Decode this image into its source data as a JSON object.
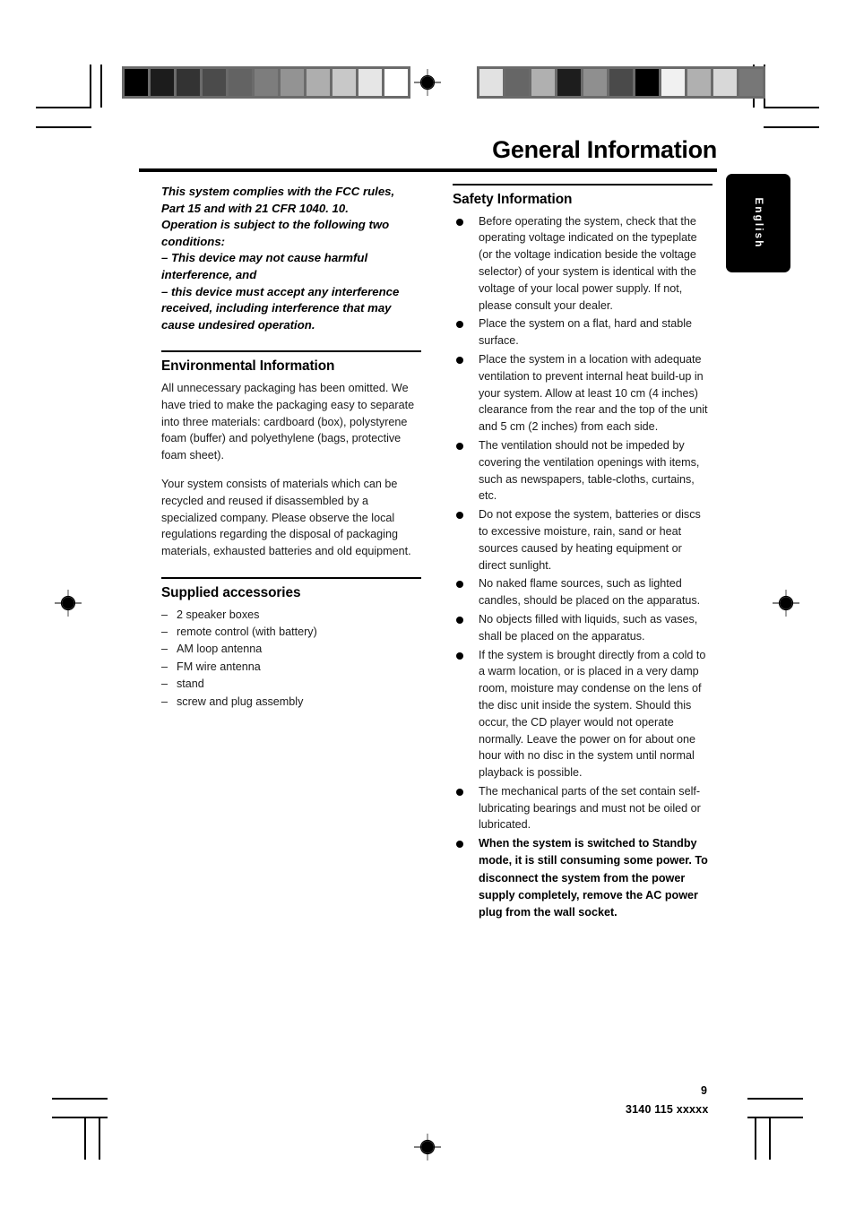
{
  "document": {
    "title": "General Information",
    "language_tab": "English",
    "page_number": "9",
    "doc_code": "3140 115 xxxxx"
  },
  "left_column": {
    "intro": {
      "lines": [
        "This system complies with the FCC rules,",
        "Part 15 and with 21 CFR 1040. 10.",
        "Operation is subject to the following two",
        "conditions:",
        "–    This device may not cause harmful",
        "interference, and",
        "–    this device must accept any interference",
        "received, including interference  that may",
        "cause undesired operation."
      ]
    },
    "environmental": {
      "heading": "Environmental Information",
      "paragraphs": [
        "All unnecessary packaging has been omitted. We have tried to make the packaging easy to separate into three materials: cardboard (box), polystyrene foam (buffer) and polyethylene (bags, protective foam sheet).",
        "Your system consists of materials which can be recycled and reused if disassembled by a specialized company. Please observe the local regulations regarding the disposal of packaging materials, exhausted batteries and old equipment."
      ]
    },
    "accessories": {
      "heading": "Supplied accessories",
      "dash": "–",
      "items": [
        "2 speaker boxes",
        "remote control (with battery)",
        "AM loop antenna",
        "FM wire antenna",
        "stand",
        "screw and plug assembly"
      ]
    }
  },
  "right_column": {
    "safety": {
      "heading": "Safety Information",
      "bullets": [
        {
          "text": "Before operating the system, check that the operating voltage indicated on the typeplate (or the voltage indication beside the voltage selector) of your system is identical with the voltage of your local power supply. If not, please consult your dealer.",
          "bold": false
        },
        {
          "text": "Place the system on a flat, hard and stable surface.",
          "bold": false
        },
        {
          "text": "Place the system in a location with adequate ventilation to prevent internal heat build-up in your system.  Allow at least 10 cm (4 inches) clearance from the rear and the top of the unit and 5 cm (2 inches) from each side.",
          "bold": false
        },
        {
          "text": "The ventilation should not be impeded by covering the ventilation openings with items, such as newspapers, table-cloths, curtains, etc.",
          "bold": false
        },
        {
          "text": "Do not expose the system, batteries or discs to excessive moisture, rain, sand or heat sources caused by heating equipment or direct sunlight.",
          "bold": false
        },
        {
          "text": "No naked flame sources, such as lighted candles, should be placed on the apparatus.",
          "bold": false
        },
        {
          "text": "No objects filled with liquids, such as vases, shall be placed on the apparatus.",
          "bold": false
        },
        {
          "text": "If the system is brought directly from a cold to a warm location, or is placed in a very damp room, moisture may condense on the lens of the disc unit inside the system. Should this occur, the CD player would not operate normally. Leave the power on for about one hour with no disc in the system until normal playback is possible.",
          "bold": false
        },
        {
          "text": "The mechanical parts of the set contain self-lubricating bearings and must not be oiled or lubricated.",
          "bold": false
        },
        {
          "text": "When the system is switched to Standby mode, it is still consuming some power. To disconnect the system from the power supply completely, remove the AC power plug from the wall socket.",
          "bold": true
        }
      ]
    }
  },
  "prepress": {
    "gray_ramp_left": [
      "#000000",
      "#1c1c1c",
      "#333333",
      "#4b4b4b",
      "#636363",
      "#7d7d7d",
      "#939393",
      "#aeaeae",
      "#c8c8c8",
      "#e6e6e6",
      "#ffffff"
    ],
    "gray_ramp_right": [
      "#e2e2e2",
      "#666666",
      "#b0b0b0",
      "#1d1d1d",
      "#8f8f8f",
      "#4a4a4a",
      "#000000",
      "#f1f1f1",
      "#b0b0b0",
      "#d8d8d8",
      "#777777"
    ],
    "registration_mark": "registration-target"
  }
}
